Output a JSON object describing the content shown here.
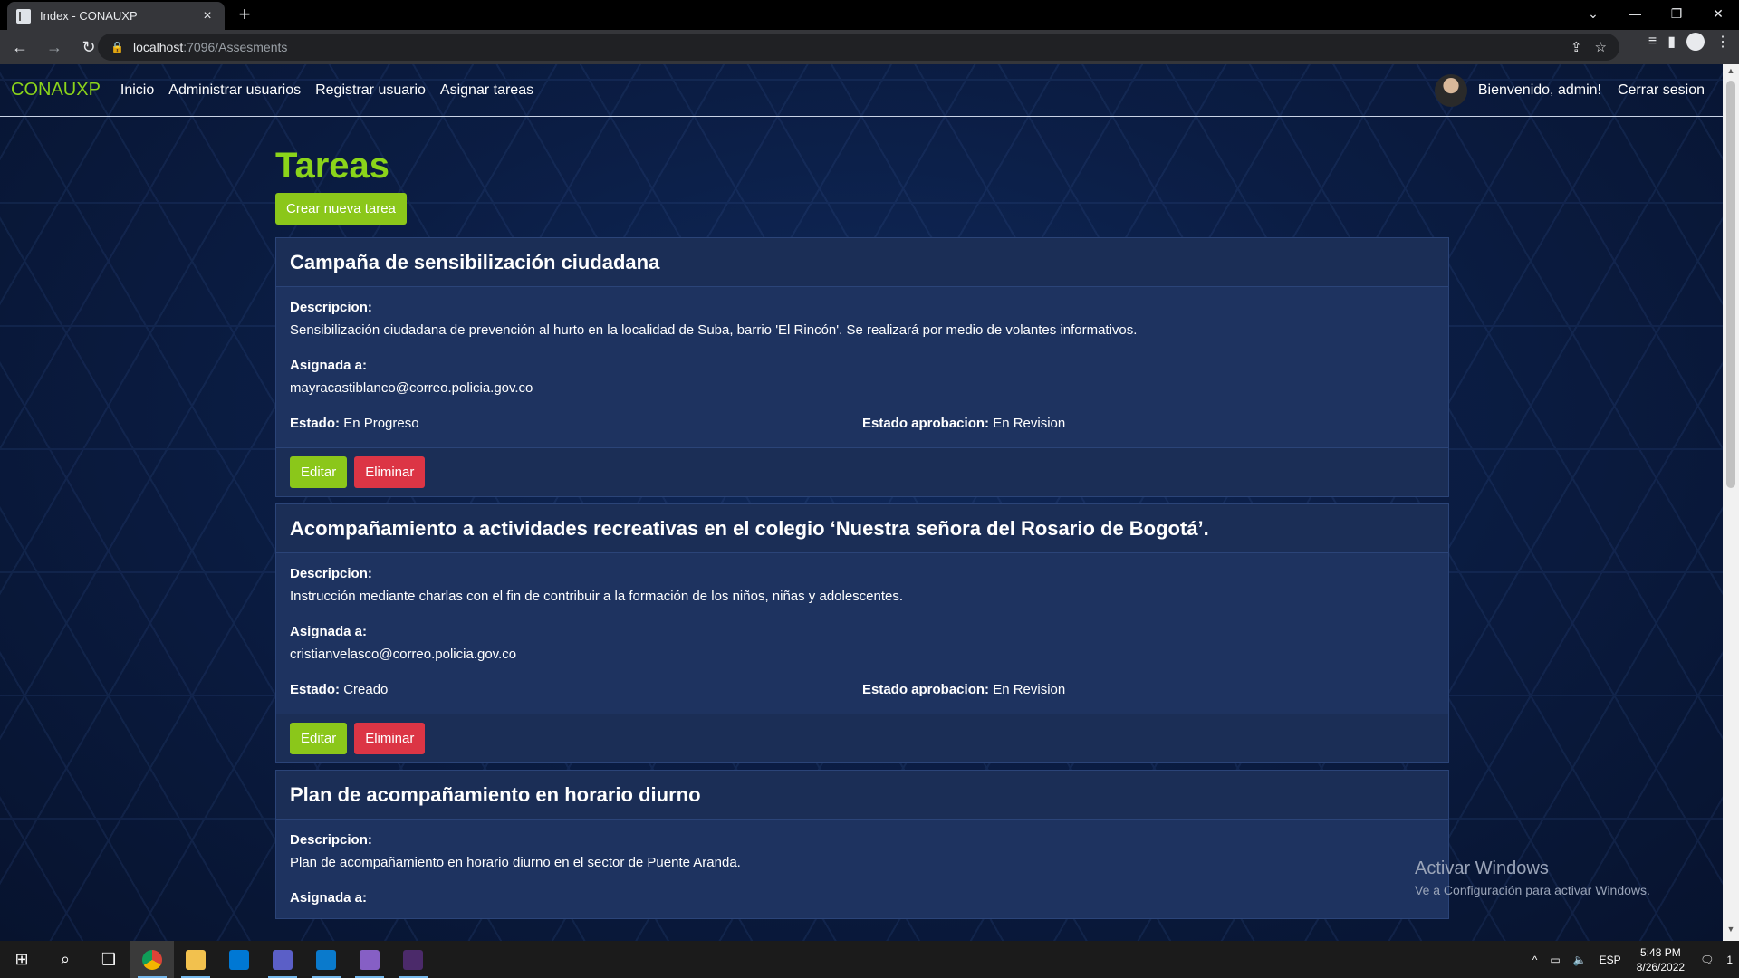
{
  "browser": {
    "tab_title": "Index - CONAUXP",
    "url_host": "localhost",
    "url_path": ":7096/Assesments"
  },
  "navbar": {
    "brand": "CONAUXP",
    "links": [
      "Inicio",
      "Administrar usuarios",
      "Registrar usuario",
      "Asignar tareas"
    ],
    "welcome": "Bienvenido, admin!",
    "logout": "Cerrar sesion"
  },
  "main": {
    "title": "Tareas",
    "create_button": "Crear nueva tarea",
    "labels": {
      "description": "Descripcion:",
      "assigned": "Asignada a:",
      "state": "Estado:",
      "approval": "Estado aprobacion:",
      "edit": "Editar",
      "delete": "Eliminar"
    },
    "tasks": [
      {
        "title": "Campaña de sensibilización ciudadana",
        "description": "Sensibilización ciudadana de prevención al hurto en la localidad de Suba, barrio 'El Rincón'. Se realizará por medio de volantes informativos.",
        "assigned_to": "mayracastiblanco@correo.policia.gov.co",
        "state": "En Progreso",
        "approval": "En Revision"
      },
      {
        "title": "Acompañamiento a actividades recreativas en el colegio ‘Nuestra señora del Rosario de Bogotá’.",
        "description": "Instrucción mediante charlas con el fin de contribuir a la formación de los niños, niñas y adolescentes.",
        "assigned_to": "cristianvelasco@correo.policia.gov.co",
        "state": "Creado",
        "approval": "En Revision"
      },
      {
        "title": "Plan de acompañamiento en horario diurno",
        "description": "Plan de acompañamiento en horario diurno en el sector de Puente Aranda."
      }
    ]
  },
  "watermark": {
    "line1": "Activar Windows",
    "line2": "Ve a Configuración para activar Windows."
  },
  "taskbar": {
    "lang": "ESP",
    "time": "5:48 PM",
    "date": "8/26/2022",
    "notifications": "1"
  }
}
